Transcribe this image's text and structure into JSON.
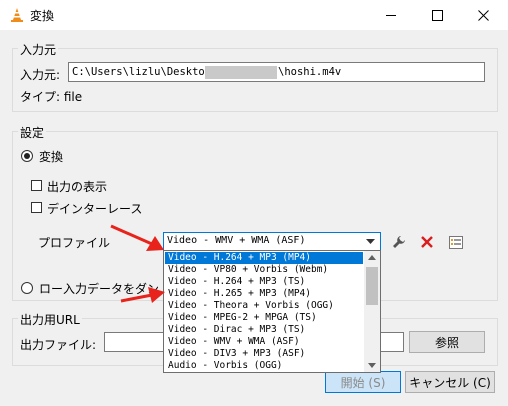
{
  "window": {
    "title": "変換"
  },
  "source": {
    "group_label": "入力元",
    "source_label": "入力元:",
    "path_start": "C:\\Users\\lizlu\\Desktop\\",
    "path_end": "\\hoshi.m4v",
    "type_label": "タイプ: file"
  },
  "settings": {
    "group_label": "設定",
    "convert_label": "変換",
    "show_output_label": "出力の表示",
    "deinterlace_label": "デインターレース",
    "profile_label": "プロファイル",
    "profile_selected": "Video - WMV + WMA (ASF)",
    "dump_label": "ロー入力データをダン"
  },
  "profile_options": [
    "Video - H.264 + MP3 (MP4)",
    "Video - VP80 + Vorbis (Webm)",
    "Video - H.264 + MP3 (TS)",
    "Video - H.265 + MP3 (MP4)",
    "Video - Theora + Vorbis (OGG)",
    "Video - MPEG-2 + MPGA (TS)",
    "Video - Dirac + MP3 (TS)",
    "Video - WMV + WMA (ASF)",
    "Video - DIV3 + MP3 (ASF)",
    "Audio - Vorbis (OGG)"
  ],
  "destination": {
    "group_label": "出力用URL",
    "file_label": "出力ファイル:",
    "browse_label": "参照"
  },
  "buttons": {
    "start_label": "開始 (S)",
    "cancel_label": "キャンセル (C)"
  },
  "colors": {
    "accent": "#0078d7",
    "arrow": "#e8231b",
    "delete": "#d81e1e"
  }
}
